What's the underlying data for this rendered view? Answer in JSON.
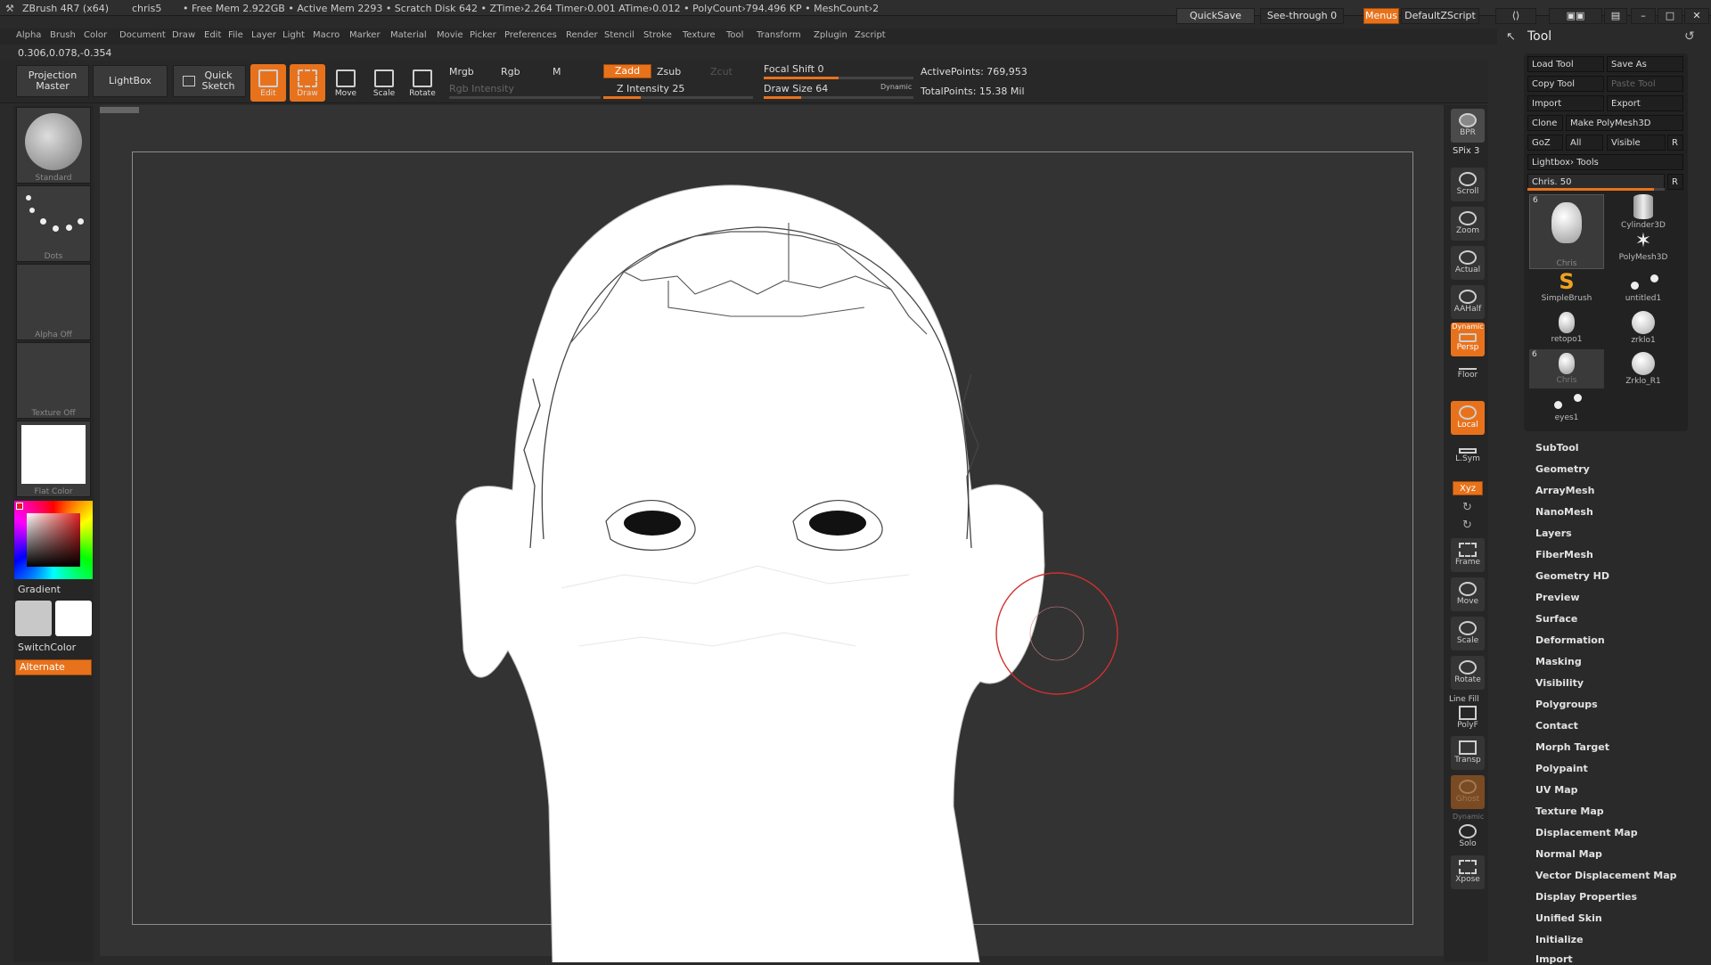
{
  "app": {
    "title": "ZBrush 4R7 (x64)",
    "user": "chris5",
    "status": "• Free Mem 2.922GB • Active Mem 2293 • Scratch Disk 642 • ZTime›2.264 Timer›0.001 ATime›0.012 • PolyCount›794.496 KP • MeshCount›2",
    "quicksave": "QuickSave",
    "see_through": "See-through 0",
    "menus": "Menus",
    "default_zscript": "DefaultZScript"
  },
  "menubar": [
    "Alpha",
    "Brush",
    "Color",
    "Document",
    "Draw",
    "Edit",
    "File",
    "Layer",
    "Light",
    "Macro",
    "Marker",
    "Material",
    "Movie",
    "Picker",
    "Preferences",
    "Render",
    "Stencil",
    "Stroke",
    "Texture",
    "Tool",
    "Transform",
    "Zplugin",
    "Zscript"
  ],
  "coords": "0.306,0.078,-0.354",
  "shelf": {
    "projection_master": "Projection Master",
    "lightbox": "LightBox",
    "quick_sketch": "Quick Sketch",
    "edit": "Edit",
    "draw": "Draw",
    "move": "Move",
    "scale": "Scale",
    "rotate": "Rotate",
    "mrgb": "Mrgb",
    "rgb": "Rgb",
    "m": "M",
    "rgb_intensity": "Rgb Intensity",
    "zadd": "Zadd",
    "zsub": "Zsub",
    "zcut": "Zcut",
    "z_intensity": "Z Intensity 25",
    "focal_shift": "Focal Shift 0",
    "draw_size": "Draw Size 64",
    "dynamic": "Dynamic",
    "active_points": "ActivePoints: 769,953",
    "total_points": "TotalPoints: 15.38 Mil"
  },
  "leftbar": {
    "brush": "Standard",
    "stroke": "Dots",
    "alpha": "Alpha Off",
    "texture": "Texture Off",
    "material": "Flat Color",
    "gradient": "Gradient",
    "switch_color": "SwitchColor",
    "alternate": "Alternate"
  },
  "rightbar": {
    "bpr": "BPR",
    "spix": "SPix 3",
    "scroll": "Scroll",
    "zoom": "Zoom",
    "actual": "Actual",
    "aahalf": "AAHalf",
    "dynamic": "Dynamic",
    "persp": "Persp",
    "floor": "Floor",
    "local": "Local",
    "lsym": "L.Sym",
    "xyz": "Xyz",
    "frame": "Frame",
    "move": "Move",
    "scale": "Scale",
    "rotate": "Rotate",
    "line_fill": "Line Fill",
    "polyf": "PolyF",
    "transp": "Transp",
    "ghost": "Ghost",
    "solo": "Solo",
    "xpose": "Xpose"
  },
  "tool_panel": {
    "title": "Tool",
    "load_tool": "Load Tool",
    "save_as": "Save As",
    "copy_tool": "Copy Tool",
    "paste_tool": "Paste Tool",
    "import": "Import",
    "export": "Export",
    "clone": "Clone",
    "make_polymesh": "Make PolyMesh3D",
    "goz": "GoZ",
    "all": "All",
    "visible": "Visible",
    "r": "R",
    "lightbox_tools": "Lightbox› Tools",
    "current_tool": "Chris. 50",
    "tools": [
      {
        "name": "Chris",
        "count": "6"
      },
      {
        "name": "Cylinder3D"
      },
      {
        "name": "PolyMesh3D"
      },
      {
        "name": "SimpleBrush"
      },
      {
        "name": "untitled1"
      },
      {
        "name": "retopo1"
      },
      {
        "name": "zrklo1"
      },
      {
        "name": "Chris",
        "count": "6"
      },
      {
        "name": "Zrklo_R1"
      },
      {
        "name": "eyes1"
      }
    ],
    "subpalettes": [
      "SubTool",
      "Geometry",
      "ArrayMesh",
      "NanoMesh",
      "Layers",
      "FiberMesh",
      "Geometry HD",
      "Preview",
      "Surface",
      "Deformation",
      "Masking",
      "Visibility",
      "Polygroups",
      "Contact",
      "Morph Target",
      "Polypaint",
      "UV Map",
      "Texture Map",
      "Displacement Map",
      "Normal Map",
      "Vector Displacement Map",
      "Display Properties",
      "Unified Skin",
      "Initialize",
      "Import"
    ]
  },
  "colors": {
    "accent": "#e8721c",
    "bg": "#2a2a2a",
    "canvas": "#333333"
  }
}
